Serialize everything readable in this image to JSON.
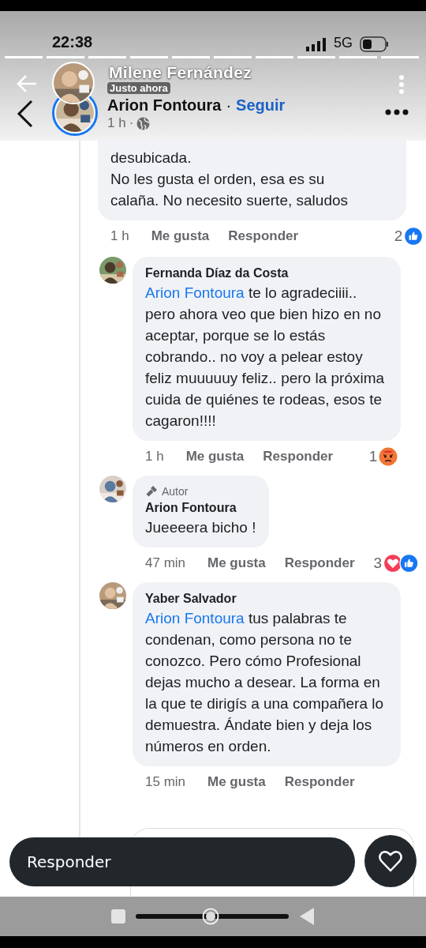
{
  "status_bar": {
    "time": "22:38",
    "network": "5G"
  },
  "story": {
    "author": "Milene Fernández",
    "time": "Justo ahora"
  },
  "post_header": {
    "author": "Arion Fontoura",
    "separator": "·",
    "follow": "Seguir",
    "time": "1 h",
    "time_separator": "·"
  },
  "comments": [
    {
      "text": "desubicada.\nNo les gusta el orden, esa es su calaña. No necesito suerte, saludos",
      "time": "1 h",
      "like": "Me gusta",
      "reply": "Responder",
      "reaction_count": "2",
      "reactions": [
        {
          "kind": "like"
        }
      ],
      "children": [
        {
          "author": "Fernanda Díaz da Costa",
          "mention": "Arion Fontoura",
          "text": "te lo agradeciiii.. pero ahora veo que bien hizo en no aceptar, porque se lo estás cobrando.. no voy a pelear estoy feliz muuuuuy feliz.. pero la próxima cuida de quiénes te rodeas, esos te cagaron!!!!",
          "time": "1 h",
          "like": "Me gusta",
          "reply": "Responder",
          "reaction_count": "1",
          "reactions": [
            {
              "kind": "angry"
            }
          ]
        },
        {
          "badge": "Autor",
          "author": "Arion Fontoura",
          "text": "Jueeeera bicho !",
          "time": "47 min",
          "like": "Me gusta",
          "reply": "Responder",
          "reaction_count": "3",
          "reactions": [
            {
              "kind": "love"
            },
            {
              "kind": "like"
            }
          ]
        },
        {
          "author": "Yaber Salvador",
          "mention": "Arion Fontoura",
          "text": "tus palabras te condenan, como persona no te conozco. Pero cómo Profesional dejas  mucho a desear. La forma en la que te dirigís a una compañera lo demuestra. Ándate bien y deja los números en orden.",
          "time": "15 min",
          "like": "Me gusta",
          "reply": "Responder"
        }
      ]
    }
  ],
  "reply_bar": {
    "label": "Responder"
  }
}
